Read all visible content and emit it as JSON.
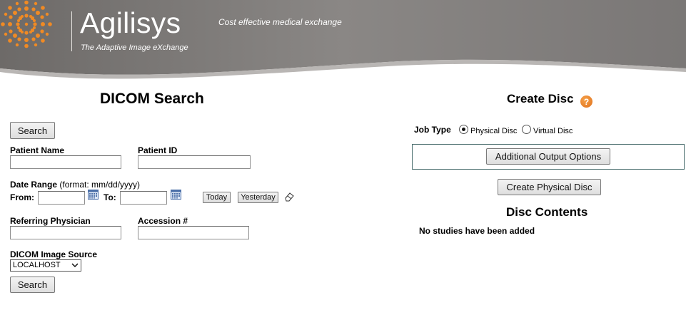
{
  "header": {
    "brand_name": "Agilisys",
    "brand_tagline": "The Adaptive Image eXchange",
    "slogan": "Cost effective medical exchange",
    "colors": {
      "bar": "#7c7c7c",
      "bar_light": "#a5a5a5",
      "logo_orange": "#f08a24"
    }
  },
  "dicom_search": {
    "title": "DICOM Search",
    "search_button_top": "Search",
    "patient_name_label": "Patient Name",
    "patient_name_value": "",
    "patient_id_label": "Patient ID",
    "patient_id_value": "",
    "date_range_label": "Date Range",
    "date_range_format": "(format: mm/dd/yyyy)",
    "from_label": "From:",
    "from_value": "",
    "to_label": "To:",
    "to_value": "",
    "today_button": "Today",
    "yesterday_button": "Yesterday",
    "referring_physician_label": "Referring Physician",
    "referring_physician_value": "",
    "accession_label": "Accession #",
    "accession_value": "",
    "image_source_label": "DICOM Image Source",
    "image_source_selected": "LOCALHOST",
    "search_button_bottom": "Search"
  },
  "create_disc": {
    "title": "Create Disc",
    "help_icon": "?",
    "job_type_label": "Job Type",
    "job_type_options": [
      {
        "label": "Physical Disc",
        "selected": true
      },
      {
        "label": "Virtual Disc",
        "selected": false
      }
    ],
    "additional_output_button": "Additional Output Options",
    "create_button": "Create Physical Disc",
    "disc_contents_title": "Disc Contents",
    "empty_message": "No studies have been added"
  }
}
